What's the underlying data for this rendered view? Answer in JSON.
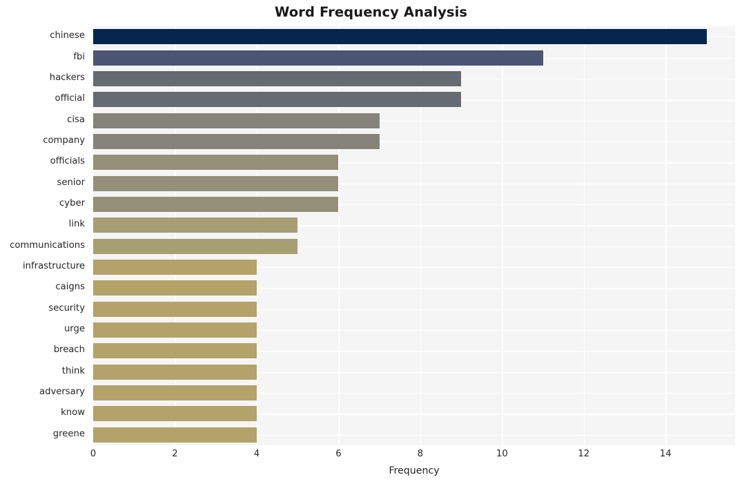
{
  "chart_data": {
    "type": "bar",
    "orientation": "horizontal",
    "title": "Word Frequency Analysis",
    "xlabel": "Frequency",
    "ylabel": "",
    "categories": [
      "chinese",
      "fbi",
      "hackers",
      "official",
      "cisa",
      "company",
      "officials",
      "senior",
      "cyber",
      "link",
      "communications",
      "infrastructure",
      "caigns",
      "security",
      "urge",
      "breach",
      "think",
      "adversary",
      "know",
      "greene"
    ],
    "values": [
      15,
      11,
      9,
      9,
      7,
      7,
      6,
      6,
      6,
      5,
      5,
      4,
      4,
      4,
      4,
      4,
      4,
      4,
      4,
      4
    ],
    "bar_colors": [
      "#04264f",
      "#4c5574",
      "#666a71",
      "#666a71",
      "#85837a",
      "#85837a",
      "#95907a",
      "#95907a",
      "#95907a",
      "#a79e74",
      "#a79e74",
      "#b3a269",
      "#b3a269",
      "#b3a269",
      "#b3a269",
      "#b3a269",
      "#b3a269",
      "#b3a269",
      "#b3a269",
      "#b3a269"
    ],
    "xlim": [
      0,
      15.7
    ],
    "xticks": [
      0,
      2,
      4,
      6,
      8,
      10,
      12,
      14
    ],
    "xtick_labels": [
      "0",
      "2",
      "4",
      "6",
      "8",
      "10",
      "12",
      "14"
    ],
    "grid": true,
    "grid_color": "#ffffff",
    "plot_background": "#f5f5f5",
    "figure_background": "#ffffff",
    "legend": null
  }
}
